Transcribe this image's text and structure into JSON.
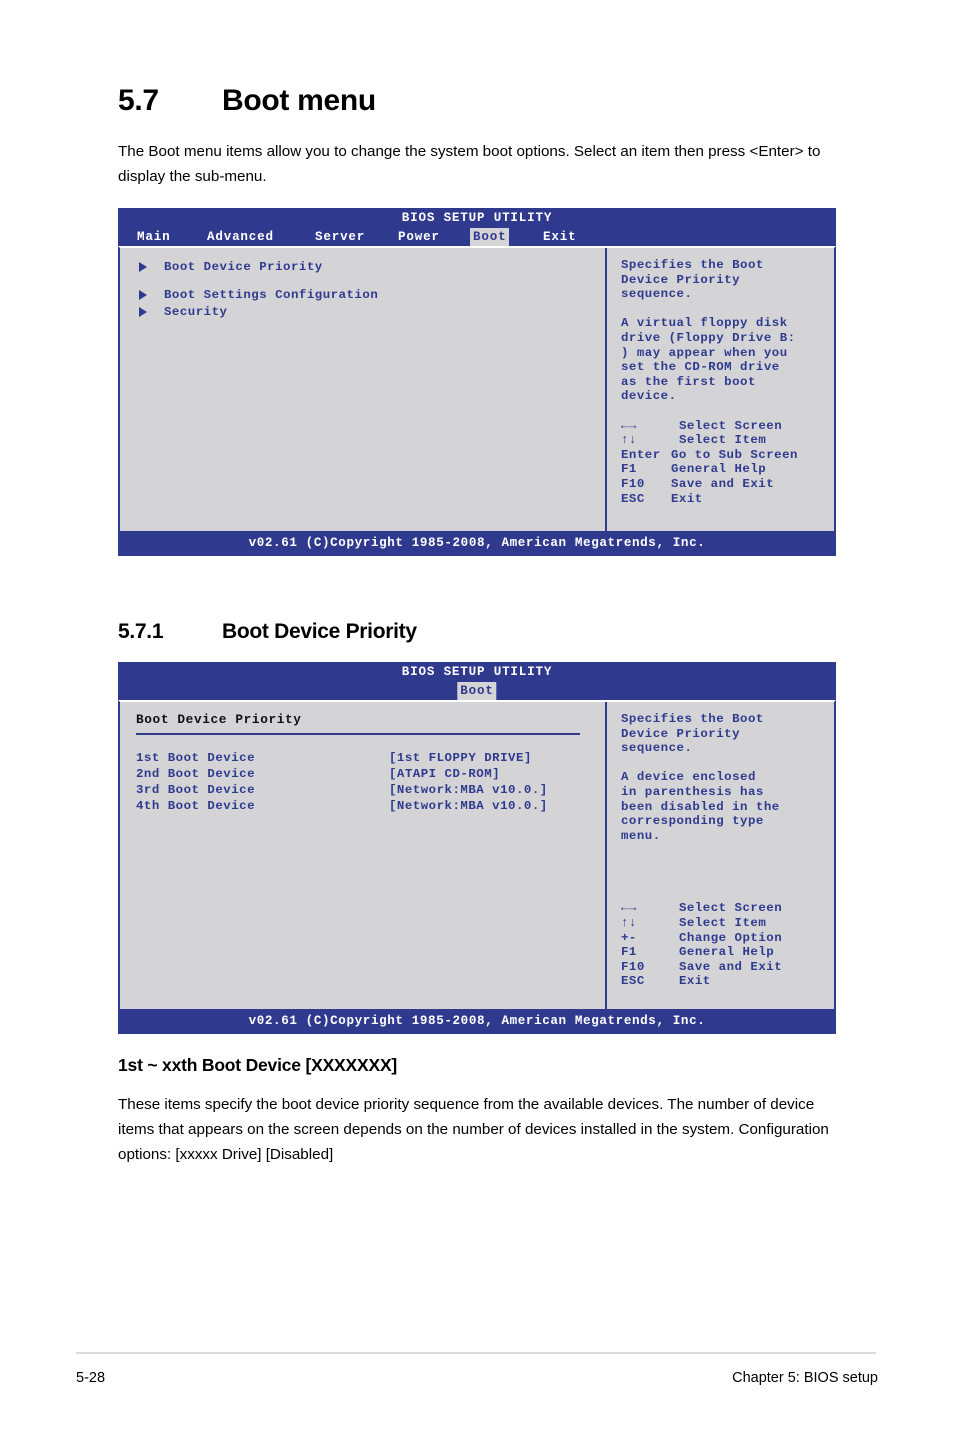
{
  "document": {
    "section": {
      "number": "5.7",
      "title": "Boot menu",
      "intro": "The Boot menu items allow you to change the system boot options. Select an item then press <Enter> to display the sub-menu."
    },
    "subsection": {
      "number": "5.7.1",
      "title": "Boot Device Priority"
    },
    "item_heading": "1st ~ xxth Boot Device [XXXXXXX]",
    "item_paragraph": "These items specify the boot device priority sequence from the available devices. The number of device items that appears on the screen depends on the number of devices installed in the system. Configuration options: [xxxxx Drive] [Disabled]",
    "footer": {
      "page_number": "5-28",
      "chapter": "Chapter 5: BIOS setup"
    }
  },
  "colors": {
    "bios_blue": "#2f3a8f",
    "bios_gray": "#d4d4d6",
    "text_blue": "#2f3a8f",
    "white": "#ffffff"
  },
  "bios_screen_1": {
    "title": "BIOS SETUP UTILITY",
    "tabs": [
      {
        "label": "Main",
        "active": false
      },
      {
        "label": "Advanced",
        "active": false
      },
      {
        "label": "Server",
        "active": false
      },
      {
        "label": "Power",
        "active": false
      },
      {
        "label": "Boot",
        "active": true
      },
      {
        "label": "Exit",
        "active": false
      }
    ],
    "menu_items": [
      {
        "label": "Boot Device Priority"
      },
      {
        "label": "Boot Settings Configuration"
      },
      {
        "label": "Security"
      }
    ],
    "help": {
      "paragraph1": "Specifies the Boot\nDevice Priority\nsequence.",
      "paragraph2": "A virtual floppy disk\ndrive (Floppy Drive B:\n) may appear when you\nset the CD-ROM drive\nas the first boot\ndevice."
    },
    "key_legend": [
      {
        "key": "←→",
        "action": "Select Screen"
      },
      {
        "key": "↑↓",
        "action": "Select Item"
      },
      {
        "key": "Enter",
        "action": "Go to Sub Screen"
      },
      {
        "key": "F1",
        "action": "General Help"
      },
      {
        "key": "F10",
        "action": "Save and Exit"
      },
      {
        "key": "ESC",
        "action": "Exit"
      }
    ],
    "footer": "v02.61 (C)Copyright 1985-2008, American Megatrends, Inc."
  },
  "bios_screen_2": {
    "title": "BIOS SETUP UTILITY",
    "tabs": [
      {
        "label": "Boot",
        "active": true
      }
    ],
    "panel_title": "Boot Device Priority",
    "devices": [
      {
        "label": "1st Boot Device",
        "value": "[1st FLOPPY DRIVE]"
      },
      {
        "label": "2nd Boot Device",
        "value": "[ATAPI CD-ROM]"
      },
      {
        "label": "3rd Boot Device",
        "value": "[Network:MBA v10.0.]"
      },
      {
        "label": "4th Boot Device",
        "value": "[Network:MBA v10.0.]"
      }
    ],
    "help": {
      "paragraph1": "Specifies the Boot\nDevice Priority\nsequence.",
      "paragraph2": "A device enclosed\nin parenthesis has\nbeen disabled in the\ncorresponding type\nmenu."
    },
    "key_legend": [
      {
        "key": "←→",
        "action": "Select Screen"
      },
      {
        "key": "↑↓",
        "action": "Select Item"
      },
      {
        "key": "+-",
        "action": "Change Option"
      },
      {
        "key": "F1",
        "action": "General Help"
      },
      {
        "key": "F10",
        "action": "Save and Exit"
      },
      {
        "key": "ESC",
        "action": "Exit"
      }
    ],
    "footer": "v02.61 (C)Copyright 1985-2008, American Megatrends, Inc."
  }
}
